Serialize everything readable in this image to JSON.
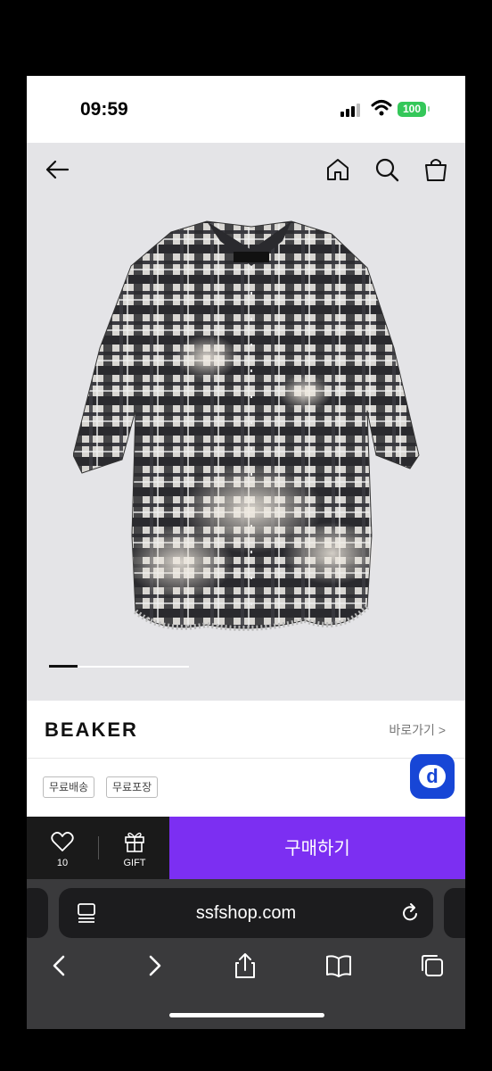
{
  "status_bar": {
    "time": "09:59",
    "battery": "100"
  },
  "brand": {
    "name": "BEAKER",
    "link_label": "바로가기 >"
  },
  "tags": [
    "무료배송",
    "무료포장"
  ],
  "badge": {
    "letter": "d"
  },
  "buy_bar": {
    "like_count": "10",
    "gift_label": "GIFT",
    "buy_label": "구매하기"
  },
  "browser": {
    "url": "ssfshop.com"
  },
  "colors": {
    "buy_button": "#7c2ff2",
    "badge": "#1746d6",
    "battery": "#34c759"
  },
  "carousel": {
    "active_index": 0
  }
}
